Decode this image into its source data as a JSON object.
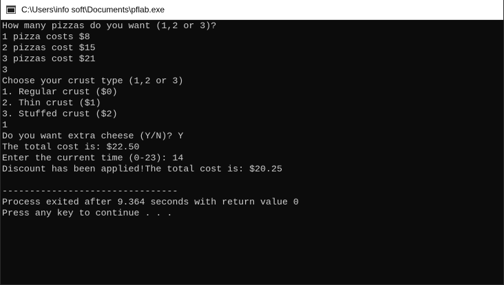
{
  "window": {
    "title": "C:\\Users\\info soft\\Documents\\pflab.exe",
    "icon": "console-app-icon"
  },
  "colors": {
    "console_background": "#0c0c0c",
    "console_text": "#cccccc",
    "titlebar_background": "#ffffff"
  },
  "console": {
    "lines": [
      "How many pizzas do you want (1,2 or 3)?",
      "1 pizza costs $8",
      "2 pizzas cost $15",
      "3 pizzas cost $21",
      "3",
      "Choose your crust type (1,2 or 3)",
      "1. Regular crust ($0)",
      "2. Thin crust ($1)",
      "3. Stuffed crust ($2)",
      "1",
      "Do you want extra cheese (Y/N)? Y",
      "The total cost is: $22.50",
      "Enter the current time (0-23): 14",
      "Discount has been applied!The total cost is: $20.25",
      "",
      "--------------------------------",
      "Process exited after 9.364 seconds with return value 0",
      "Press any key to continue . . ."
    ]
  }
}
